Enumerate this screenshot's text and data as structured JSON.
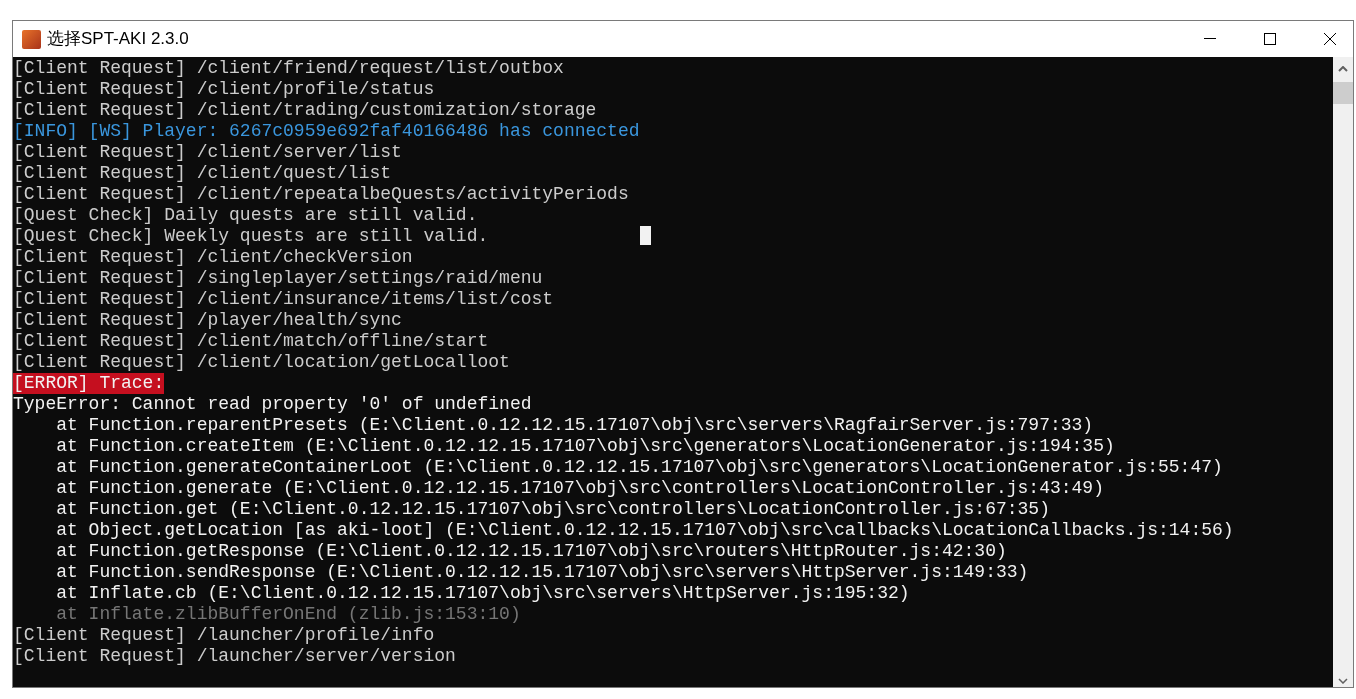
{
  "window": {
    "title": "选择SPT-AKI 2.3.0"
  },
  "console": {
    "lines": [
      {
        "kind": "request",
        "text": "[Client Request] /client/friend/request/list/outbox"
      },
      {
        "kind": "request",
        "text": "[Client Request] /client/profile/status"
      },
      {
        "kind": "request",
        "text": "[Client Request] /client/trading/customization/storage"
      },
      {
        "kind": "info",
        "text": "[INFO] [WS] Player: 6267c0959e692faf40166486 has connected"
      },
      {
        "kind": "request",
        "text": "[Client Request] /client/server/list"
      },
      {
        "kind": "request",
        "text": "[Client Request] /client/quest/list"
      },
      {
        "kind": "request",
        "text": "[Client Request] /client/repeatalbeQuests/activityPeriods"
      },
      {
        "kind": "request",
        "text": "[Quest Check] Daily quests are still valid."
      },
      {
        "kind": "request",
        "text": "[Quest Check] Weekly quests are still valid."
      },
      {
        "kind": "request",
        "text": "[Client Request] /client/checkVersion"
      },
      {
        "kind": "request",
        "text": "[Client Request] /singleplayer/settings/raid/menu"
      },
      {
        "kind": "request",
        "text": "[Client Request] /client/insurance/items/list/cost"
      },
      {
        "kind": "request",
        "text": "[Client Request] /player/health/sync"
      },
      {
        "kind": "request",
        "text": "[Client Request] /client/match/offline/start"
      },
      {
        "kind": "request",
        "text": "[Client Request] /client/location/getLocalloot"
      },
      {
        "kind": "error",
        "text": "[ERROR] Trace:"
      },
      {
        "kind": "plain",
        "text": "TypeError: Cannot read property '0' of undefined"
      },
      {
        "kind": "plain",
        "text": "    at Function.reparentPresets (E:\\Client.0.12.12.15.17107\\obj\\src\\servers\\RagfairServer.js:797:33)"
      },
      {
        "kind": "plain",
        "text": "    at Function.createItem (E:\\Client.0.12.12.15.17107\\obj\\src\\generators\\LocationGenerator.js:194:35)"
      },
      {
        "kind": "plain",
        "text": "    at Function.generateContainerLoot (E:\\Client.0.12.12.15.17107\\obj\\src\\generators\\LocationGenerator.js:55:47)"
      },
      {
        "kind": "plain",
        "text": "    at Function.generate (E:\\Client.0.12.12.15.17107\\obj\\src\\controllers\\LocationController.js:43:49)"
      },
      {
        "kind": "plain",
        "text": "    at Function.get (E:\\Client.0.12.12.15.17107\\obj\\src\\controllers\\LocationController.js:67:35)"
      },
      {
        "kind": "plain",
        "text": "    at Object.getLocation [as aki-loot] (E:\\Client.0.12.12.15.17107\\obj\\src\\callbacks\\LocationCallbacks.js:14:56)"
      },
      {
        "kind": "plain",
        "text": "    at Function.getResponse (E:\\Client.0.12.12.15.17107\\obj\\src\\routers\\HttpRouter.js:42:30)"
      },
      {
        "kind": "plain",
        "text": "    at Function.sendResponse (E:\\Client.0.12.12.15.17107\\obj\\src\\servers\\HttpServer.js:149:33)"
      },
      {
        "kind": "plain",
        "text": "    at Inflate.cb (E:\\Client.0.12.12.15.17107\\obj\\src\\servers\\HttpServer.js:195:32)"
      },
      {
        "kind": "dim",
        "text": "    at Inflate.zlibBufferOnEnd (zlib.js:153:10)"
      },
      {
        "kind": "request",
        "text": "[Client Request] /launcher/profile/info"
      },
      {
        "kind": "request",
        "text": "[Client Request] /launcher/server/version"
      }
    ]
  }
}
